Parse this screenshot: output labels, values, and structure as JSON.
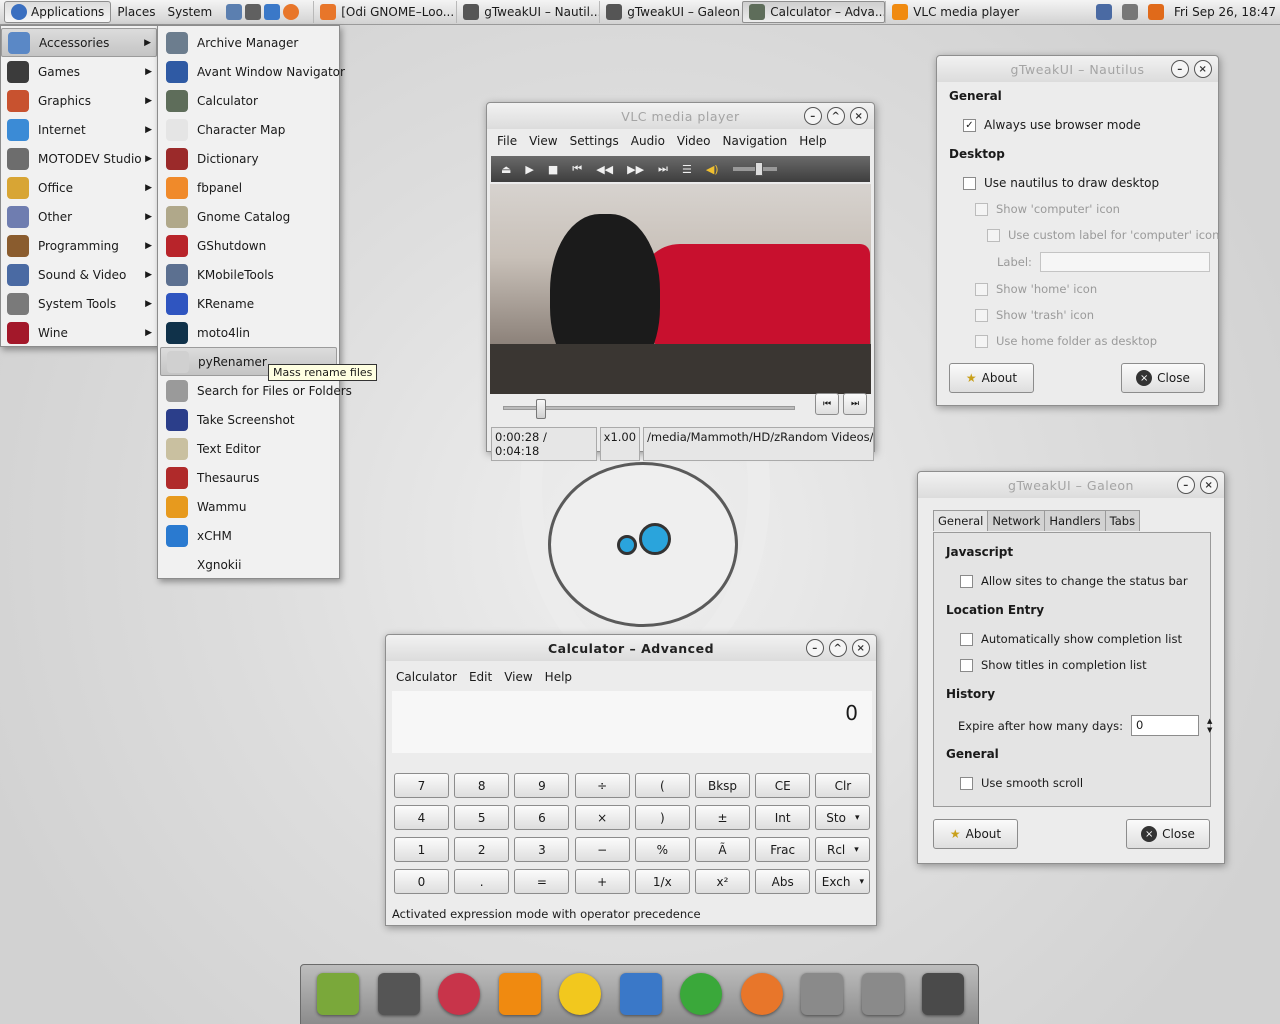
{
  "panel": {
    "applications": "Applications",
    "places": "Places",
    "system": "System",
    "tasks": [
      {
        "label": "[Odi GNOME–Loo...",
        "icon": "firefox-icon"
      },
      {
        "label": "gTweakUI – Nautil...",
        "icon": "gtweakui-icon"
      },
      {
        "label": "gTweakUI – Galeon",
        "icon": "gtweakui-icon"
      },
      {
        "label": "Calculator – Adva...",
        "icon": "calculator-icon"
      },
      {
        "label": "VLC media player",
        "icon": "vlc-icon"
      }
    ],
    "clock": "Fri Sep 26, 18:47"
  },
  "categories": [
    {
      "label": "Accessories",
      "color": "#5a88c6"
    },
    {
      "label": "Games",
      "color": "#3b3b3b"
    },
    {
      "label": "Graphics",
      "color": "#c8522f"
    },
    {
      "label": "Internet",
      "color": "#3b8bd6"
    },
    {
      "label": "MOTODEV Studio",
      "color": "#6d6d6d"
    },
    {
      "label": "Office",
      "color": "#d8a534"
    },
    {
      "label": "Other",
      "color": "#6f7db0"
    },
    {
      "label": "Programming",
      "color": "#8a5c2e"
    },
    {
      "label": "Sound & Video",
      "color": "#4a6aa3"
    },
    {
      "label": "System Tools",
      "color": "#7a7a7a"
    },
    {
      "label": "Wine",
      "color": "#a3182a"
    }
  ],
  "accessories": [
    {
      "label": "Archive Manager",
      "color": "#6c7d8e"
    },
    {
      "label": "Avant Window Navigator",
      "color": "#2f5aa4"
    },
    {
      "label": "Calculator",
      "color": "#5e6d5a"
    },
    {
      "label": "Character Map",
      "color": "#e5e5e5"
    },
    {
      "label": "Dictionary",
      "color": "#9b2a2a"
    },
    {
      "label": "fbpanel",
      "color": "#f08a2a"
    },
    {
      "label": "Gnome Catalog",
      "color": "#b0a88a"
    },
    {
      "label": "GShutdown",
      "color": "#b8242a"
    },
    {
      "label": "KMobileTools",
      "color": "#5c7090"
    },
    {
      "label": "KRename",
      "color": "#2f55c0"
    },
    {
      "label": "moto4lin",
      "color": "#10324a"
    },
    {
      "label": "pyRenamer",
      "color": "#d0d0d0"
    },
    {
      "label": "Search for Files or Folders",
      "color": "#9a9a9a"
    },
    {
      "label": "Take Screenshot",
      "color": "#2b3e8a"
    },
    {
      "label": "Text Editor",
      "color": "#c9c0a0"
    },
    {
      "label": "Thesaurus",
      "color": "#b02a2a"
    },
    {
      "label": "Wammu",
      "color": "#e79a1e"
    },
    {
      "label": "xCHM",
      "color": "#2a7ad0"
    },
    {
      "label": "Xgnokii",
      "color": "#f1f1f1"
    }
  ],
  "tooltip": "Mass rename files",
  "vlc": {
    "title": "VLC media player",
    "menu": [
      "File",
      "View",
      "Settings",
      "Audio",
      "Video",
      "Navigation",
      "Help"
    ],
    "time": "0:00:28 / 0:04:18",
    "speed": "x1.00",
    "path": "/media/Mammoth/HD/zRandom Videos/Fo",
    "progress": 0.11,
    "volume": 0.6
  },
  "nautilus": {
    "title": "gTweakUI – Nautilus",
    "general": "General",
    "browser_mode": "Always use browser mode",
    "desktop": "Desktop",
    "draw_desktop": "Use nautilus to draw desktop",
    "show_computer": "Show 'computer' icon",
    "custom_label": "Use custom label for 'computer' icon",
    "label": "Label:",
    "show_home": "Show 'home' icon",
    "show_trash": "Show 'trash' icon",
    "home_folder": "Use home folder as desktop",
    "about": "About",
    "close": "Close"
  },
  "galeon": {
    "title": "gTweakUI – Galeon",
    "tabs": [
      "General",
      "Network",
      "Handlers",
      "Tabs"
    ],
    "javascript": "Javascript",
    "status_bar": "Allow sites to change the status bar",
    "location": "Location Entry",
    "auto_complete": "Automatically show completion list",
    "show_titles": "Show titles in completion list",
    "history": "History",
    "expire": "Expire after how many days:",
    "expire_value": "0",
    "general": "General",
    "smooth": "Use smooth scroll",
    "about": "About",
    "close": "Close"
  },
  "calculator": {
    "title": "Calculator – Advanced",
    "menu": [
      "Calculator",
      "Edit",
      "View",
      "Help"
    ],
    "display": "0",
    "keys": [
      [
        "7",
        "8",
        "9",
        "÷",
        "(",
        "Bksp",
        "CE",
        "Clr"
      ],
      [
        "4",
        "5",
        "6",
        "×",
        ")",
        "±",
        "Int",
        "Sto"
      ],
      [
        "1",
        "2",
        "3",
        "−",
        "%",
        "Ã",
        "Frac",
        "Rcl"
      ],
      [
        "0",
        ".",
        "=",
        "+",
        "1/x",
        "x²",
        "Abs",
        "Exch"
      ]
    ],
    "status": "Activated expression mode with operator precedence"
  },
  "dock": [
    "trash-icon",
    "clapper-icon",
    "cd-icon",
    "vlc-icon",
    "smiley-icon",
    "drop-icon",
    "play-icon",
    "firefox-icon",
    "gtweakui-icon",
    "gtweakui-icon",
    "calculator-icon"
  ]
}
